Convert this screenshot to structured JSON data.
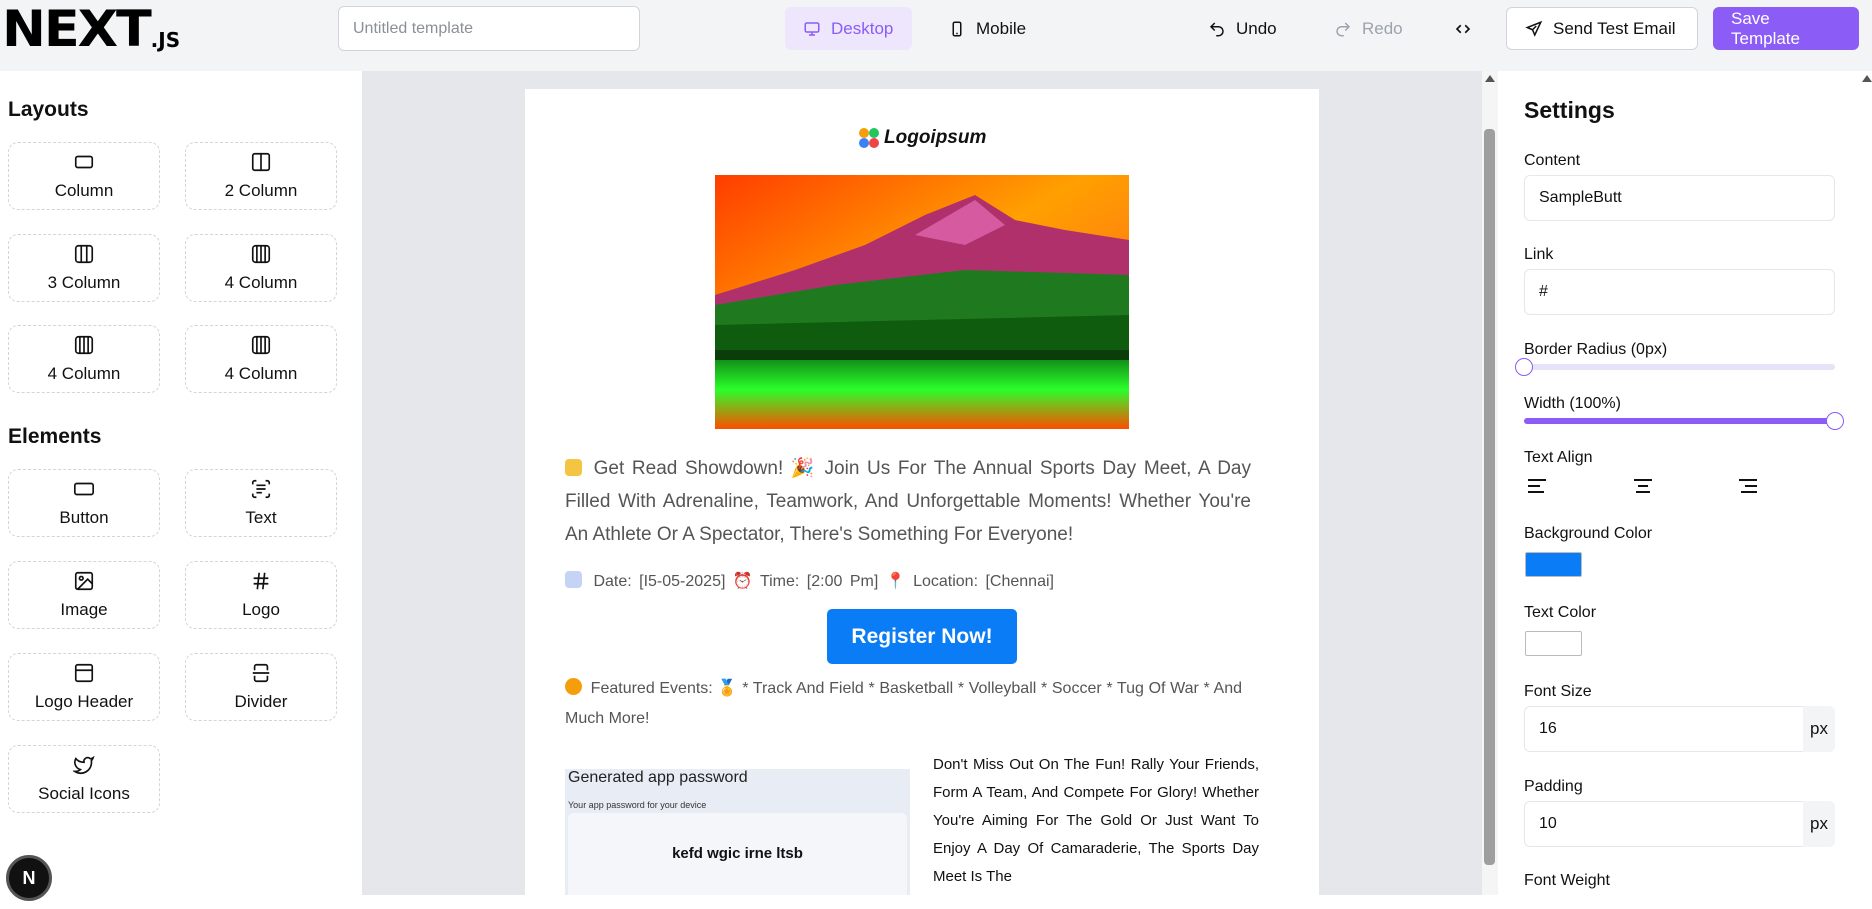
{
  "brand": {
    "main": "NEXT",
    "suffix": ".JS"
  },
  "header": {
    "title_placeholder": "Untitled template",
    "desktop_label": "Desktop",
    "mobile_label": "Mobile",
    "undo_label": "Undo",
    "redo_label": "Redo",
    "send_label": "Send Test Email",
    "save_label": "Save Template"
  },
  "sidebar": {
    "layouts_title": "Layouts",
    "layouts": [
      {
        "label": "Column",
        "icon": "column-icon"
      },
      {
        "label": "2 Column",
        "icon": "two-column-icon"
      },
      {
        "label": "3 Column",
        "icon": "three-column-icon"
      },
      {
        "label": "4 Column",
        "icon": "four-column-icon"
      },
      {
        "label": "4 Column",
        "icon": "four-column-icon"
      },
      {
        "label": "4 Column",
        "icon": "four-column-icon"
      }
    ],
    "elements_title": "Elements",
    "elements": [
      {
        "label": "Button",
        "icon": "button-icon"
      },
      {
        "label": "Text",
        "icon": "text-icon"
      },
      {
        "label": "Image",
        "icon": "image-icon"
      },
      {
        "label": "Logo",
        "icon": "logo-icon"
      },
      {
        "label": "Logo Header",
        "icon": "logo-header-icon"
      },
      {
        "label": "Divider",
        "icon": "divider-icon"
      },
      {
        "label": "Social Icons",
        "icon": "twitter-icon"
      }
    ]
  },
  "email": {
    "logo_text": "Logoipsum",
    "headline": "Get Read Showdown! 🎉 Join Us For The Annual Sports Day Meet, A Day Filled With Adrenaline, Teamwork, And Unforgettable Moments! Whether You're An Athlete Or A Spectator, There's Something For Everyone!",
    "details": "Date: [I5-05-2025] ⏰ Time: [2:00 Pm] 📍 Location: [Chennai]",
    "button_label": "Register Now!",
    "featured": "Featured Events: 🏅 * Track And Field * Basketball * Volleyball * Soccer * Tug Of War * And Much More!",
    "screenshot_heading": "Generated app password",
    "screenshot_sub": "Your app password for your device",
    "screenshot_password": "kefd wgic irne ltsb",
    "side_text": "Don't Miss Out On The Fun! Rally Your Friends, Form A Team, And Compete For Glory! Whether You're Aiming For The Gold Or Just Want To Enjoy A Day Of Camaraderie, The Sports Day Meet Is The"
  },
  "settings": {
    "title": "Settings",
    "content_label": "Content",
    "content_value": "SampleButt",
    "link_label": "Link",
    "link_value": "#",
    "border_radius_label": "Border Radius (0px)",
    "border_radius_value": 0,
    "width_label": "Width (100%)",
    "width_value": 1,
    "text_align_label": "Text Align",
    "bg_color_label": "Background Color",
    "bg_color": "#0a7cf5",
    "text_color_label": "Text Color",
    "text_color": "#ffffff",
    "font_size_label": "Font Size",
    "font_size_value": "16",
    "font_size_unit": "px",
    "padding_label": "Padding",
    "padding_value": "10",
    "padding_unit": "px",
    "font_weight_label": "Font Weight"
  },
  "badge": "N",
  "colors": {
    "accent": "#8b5cf6",
    "accent_light": "#ede6fd",
    "canvas": "#e5e7eb"
  }
}
